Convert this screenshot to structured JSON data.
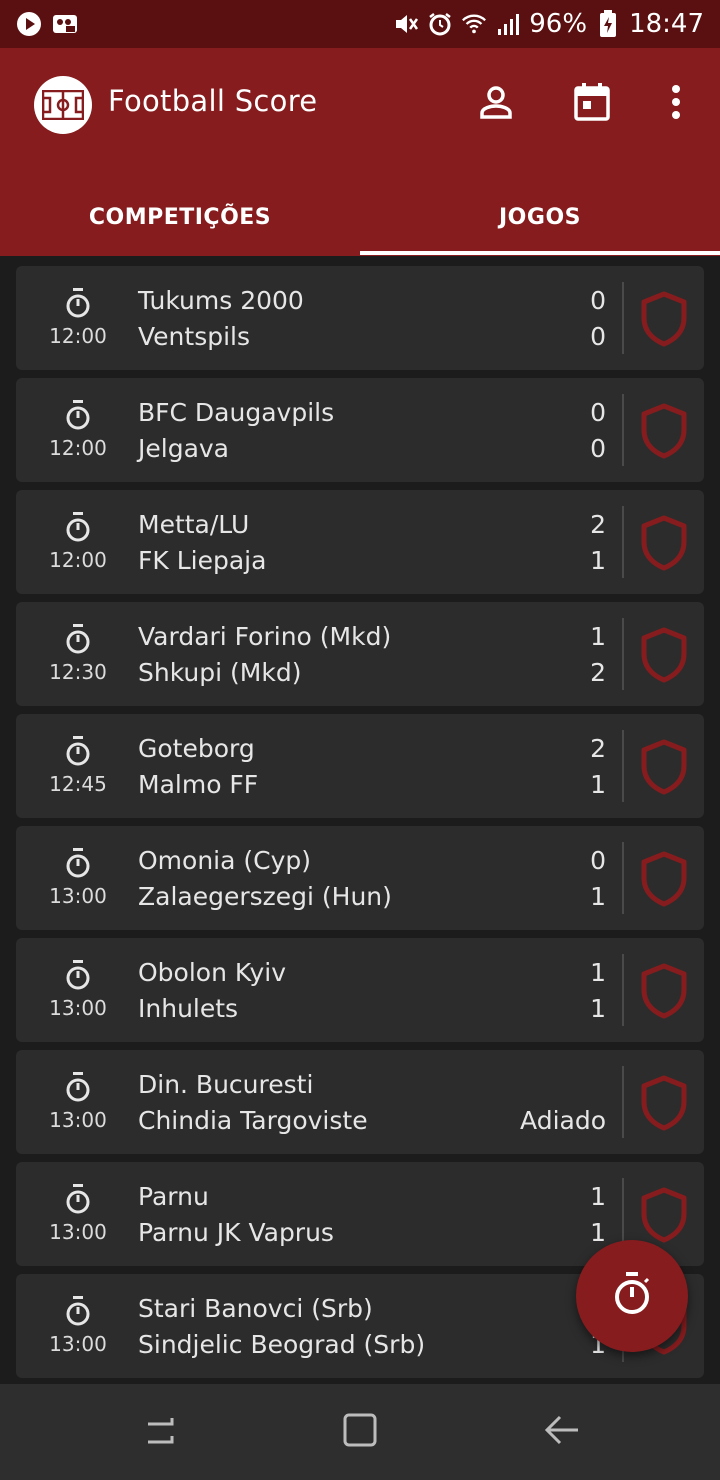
{
  "status_bar": {
    "battery": "96%",
    "time": "18:47"
  },
  "app": {
    "title": "Football Score"
  },
  "tabs": [
    {
      "label": "COMPETIÇÕES",
      "selected": false
    },
    {
      "label": "JOGOS",
      "selected": true
    }
  ],
  "matches": [
    {
      "time": "12:00",
      "home": "Tukums 2000",
      "away": "Ventspils",
      "home_score": "0",
      "away_score": "0"
    },
    {
      "time": "12:00",
      "home": "BFC Daugavpils",
      "away": "Jelgava",
      "home_score": "0",
      "away_score": "0"
    },
    {
      "time": "12:00",
      "home": "Metta/LU",
      "away": "FK Liepaja",
      "home_score": "2",
      "away_score": "1"
    },
    {
      "time": "12:30",
      "home": "Vardari Forino (Mkd)",
      "away": "Shkupi (Mkd)",
      "home_score": "1",
      "away_score": "2"
    },
    {
      "time": "12:45",
      "home": "Goteborg",
      "away": "Malmo FF",
      "home_score": "2",
      "away_score": "1"
    },
    {
      "time": "13:00",
      "home": "Omonia (Cyp)",
      "away": "Zalaegerszegi (Hun)",
      "home_score": "0",
      "away_score": "1"
    },
    {
      "time": "13:00",
      "home": "Obolon Kyiv",
      "away": "Inhulets",
      "home_score": "1",
      "away_score": "1"
    },
    {
      "time": "13:00",
      "home": "Din. Bucuresti",
      "away": "Chindia Targoviste",
      "home_score": "",
      "away_score": "Adiado"
    },
    {
      "time": "13:00",
      "home": "Parnu",
      "away": "Parnu JK Vaprus",
      "home_score": "1",
      "away_score": "1"
    },
    {
      "time": "13:00",
      "home": "Stari Banovci (Srb)",
      "away": "Sindjelic Beograd (Srb)",
      "home_score": "",
      "away_score": "1"
    }
  ],
  "colors": {
    "primary": "#861c1e",
    "status_bar": "#5a0f10",
    "card": "#2c2c2c",
    "background": "#1c1c1c"
  },
  "icons": {
    "actions": [
      "person-icon",
      "calendar-icon",
      "more-vert-icon"
    ],
    "fab": "stopwatch-icon",
    "nav": [
      "recent-apps-icon",
      "home-icon",
      "back-icon"
    ]
  }
}
